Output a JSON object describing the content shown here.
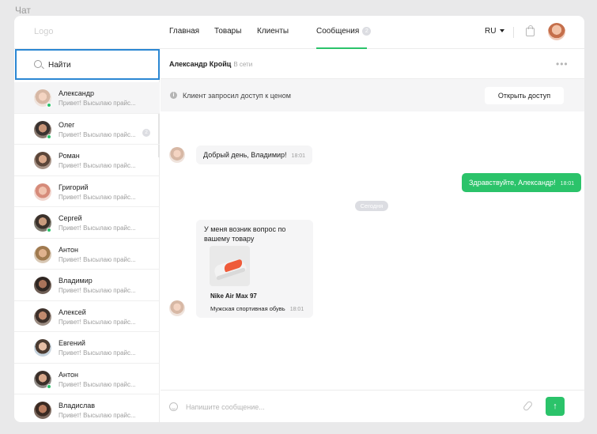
{
  "page_label": "Чат",
  "header": {
    "logo": "Logo",
    "nav": [
      {
        "label": "Главная"
      },
      {
        "label": "Товары"
      },
      {
        "label": "Клиенты"
      },
      {
        "label": "Сообщения",
        "badge": "2",
        "active": true
      }
    ],
    "language": "RU"
  },
  "sidebar": {
    "search": {
      "placeholder": "Найти"
    },
    "contacts": [
      {
        "name": "Александр",
        "preview": "Привет! Высылаю прайс...",
        "online": true,
        "active": true
      },
      {
        "name": "Олег",
        "preview": "Привет! Высылаю прайс...",
        "online": true,
        "badge": "2"
      },
      {
        "name": "Роман",
        "preview": "Привет! Высылаю прайс..."
      },
      {
        "name": "Григорий",
        "preview": "Привет! Высылаю прайс..."
      },
      {
        "name": "Сергей",
        "preview": "Привет! Высылаю прайс...",
        "online": true
      },
      {
        "name": "Антон",
        "preview": "Привет! Высылаю прайс..."
      },
      {
        "name": "Владимир",
        "preview": "Привет! Высылаю прайс..."
      },
      {
        "name": "Алексей",
        "preview": "Привет! Высылаю прайс..."
      },
      {
        "name": "Евгений",
        "preview": "Привет! Высылаю прайс..."
      },
      {
        "name": "Антон",
        "preview": "Привет! Высылаю прайс...",
        "online": true
      },
      {
        "name": "Владислав",
        "preview": "Привет! Высылаю прайс..."
      }
    ]
  },
  "chat": {
    "contact_name": "Александр Кройц",
    "status": "В сети",
    "notice_text": "Клиент запросил доступ к ценом",
    "open_access_label": "Открыть доступ",
    "messages": [
      {
        "direction": "in",
        "text": "Добрый день, Владимир!",
        "time": "18:01"
      },
      {
        "direction": "out",
        "text": "Здравствуйте, Александр!",
        "time": "18:01"
      }
    ],
    "date_divider": "Сегодня",
    "product_message": {
      "text": "У меня возник вопрос по вашему товару",
      "product_name": "Nike Air Max 97",
      "product_category": "Мужская спортивная обувь",
      "time": "18:01"
    },
    "composer_placeholder": "Напишите сообщение...",
    "send_icon": "arrow-up-icon"
  },
  "colors": {
    "accent_green": "#2bc36a",
    "focus_blue": "#2b87d3"
  }
}
